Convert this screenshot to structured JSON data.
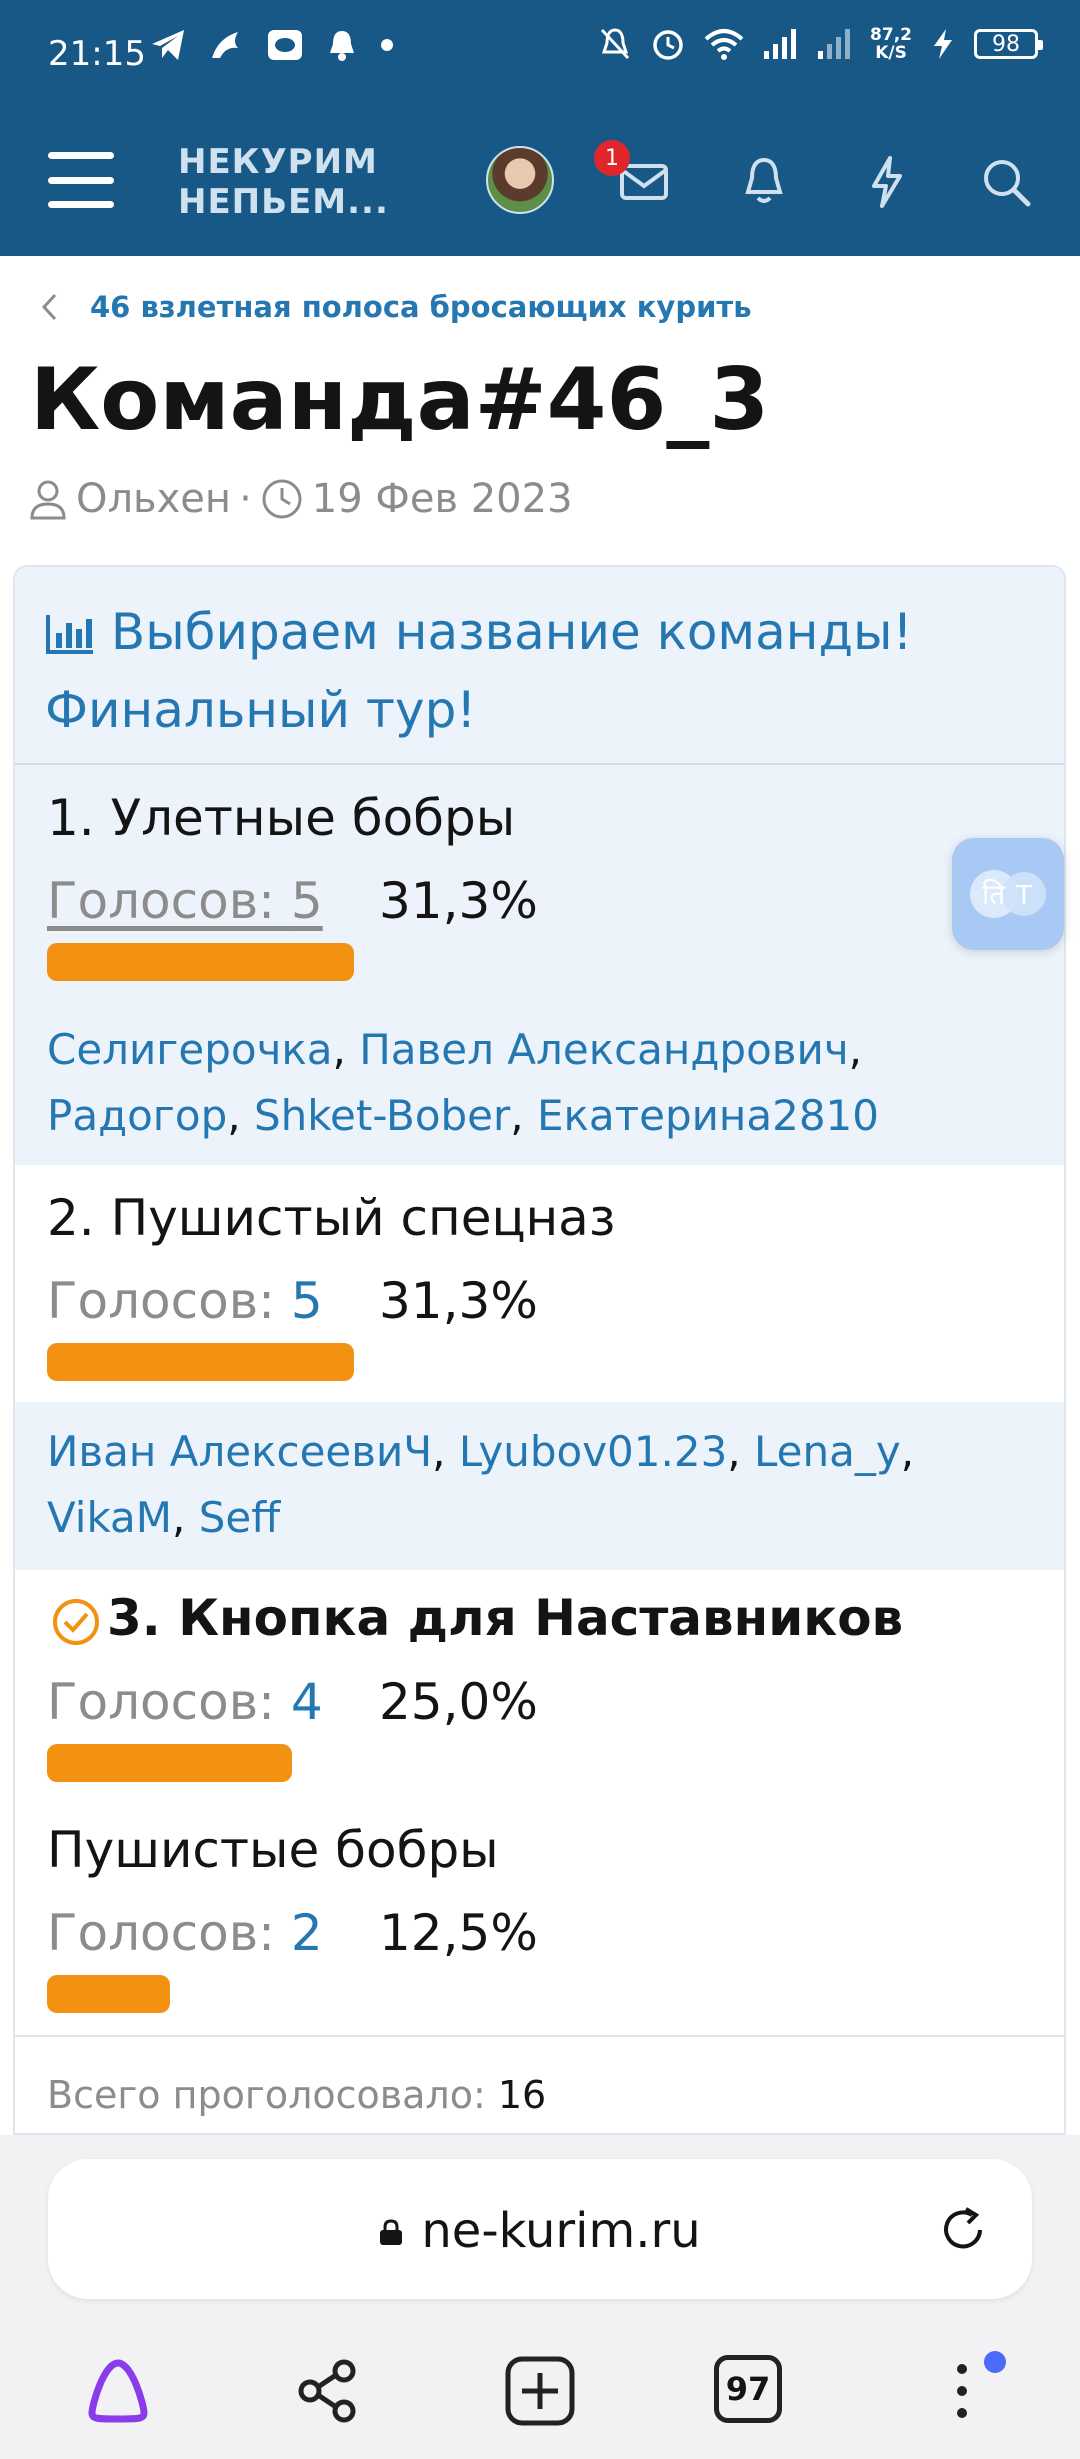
{
  "status": {
    "time": "21:15",
    "speed_value": "87,2",
    "speed_unit": "K/S",
    "battery": "98"
  },
  "header": {
    "logo_line1": "НЕКУРИМ",
    "logo_line2": "НЕПЬЕМ...",
    "notification_count": "1"
  },
  "breadcrumb": "46 взлетная полоса бросающих курить",
  "page": {
    "title": "Команда#46_3",
    "author": "Ольхен",
    "separator": "·",
    "date": "19 Фев 2023"
  },
  "poll": {
    "title_line1": "Выбираем название команды!",
    "title_line2": "Финальный тур!",
    "votes_label": "Голосов: ",
    "options": [
      {
        "label": "1. Улетные бобры",
        "votes": "5",
        "percent": "31,3%",
        "share": 0.313,
        "voters": [
          "Селигерочка",
          "Павел Александрович",
          "Радогор",
          "Shket-Bober",
          "Екатерина2810"
        ]
      },
      {
        "label": "2. Пушистый спецназ",
        "votes": "5",
        "percent": "31,3%",
        "share": 0.313,
        "voters": [
          "Иван АлексеевиЧ",
          "Lyubov01.23",
          "Lena_y",
          "VikaM",
          "Seff"
        ]
      },
      {
        "label": "3. Кнопка для Наставников",
        "votes": "4",
        "percent": "25,0%",
        "share": 0.25,
        "selected": true
      },
      {
        "label": "Пушистые бобры",
        "votes": "2",
        "percent": "12,5%",
        "share": 0.125
      }
    ],
    "total_label": "Всего проголосовало: ",
    "total": "16"
  },
  "browser": {
    "url": "ne-kurim.ru",
    "tab_count": "97"
  },
  "colors": {
    "header_bg": "#185886",
    "link": "#2577b1",
    "bar": "#f39112",
    "option_bg": "#edf3fa"
  }
}
